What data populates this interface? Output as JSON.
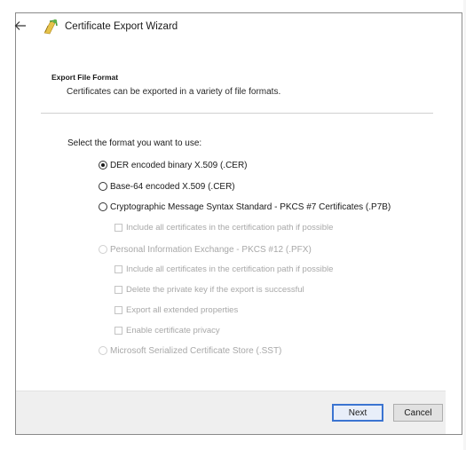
{
  "wizard": {
    "title": "Certificate Export Wizard",
    "section_heading": "Export File Format",
    "section_description": "Certificates can be exported in a variety of file formats.",
    "prompt": "Select the format you want to use:"
  },
  "options": {
    "der": {
      "label": "DER encoded binary X.509 (.CER)",
      "selected": true,
      "enabled": true
    },
    "base64": {
      "label": "Base-64 encoded X.509 (.CER)",
      "selected": false,
      "enabled": true
    },
    "pkcs7": {
      "label": "Cryptographic Message Syntax Standard - PKCS #7 Certificates (.P7B)",
      "selected": false,
      "enabled": true
    },
    "pkcs7_include": {
      "label": "Include all certificates in the certification path if possible",
      "checked": false,
      "enabled": false
    },
    "pfx": {
      "label": "Personal Information Exchange - PKCS #12 (.PFX)",
      "selected": false,
      "enabled": false
    },
    "pfx_include": {
      "label": "Include all certificates in the certification path if possible",
      "checked": false,
      "enabled": false
    },
    "pfx_delete_key": {
      "label": "Delete the private key if the export is successful",
      "checked": false,
      "enabled": false
    },
    "pfx_export_props": {
      "label": "Export all extended properties",
      "checked": false,
      "enabled": false
    },
    "pfx_privacy": {
      "label": "Enable certificate privacy",
      "checked": false,
      "enabled": false
    },
    "sst": {
      "label": "Microsoft Serialized Certificate Store (.SST)",
      "selected": false,
      "enabled": false
    }
  },
  "buttons": {
    "next": "Next",
    "cancel": "Cancel"
  },
  "icons": {
    "back": "back-arrow-icon",
    "wizard": "certificate-icon"
  },
  "colors": {
    "accent": "#3b74d1",
    "footer": "#efefef",
    "disabled_text": "#a8a8a8"
  }
}
